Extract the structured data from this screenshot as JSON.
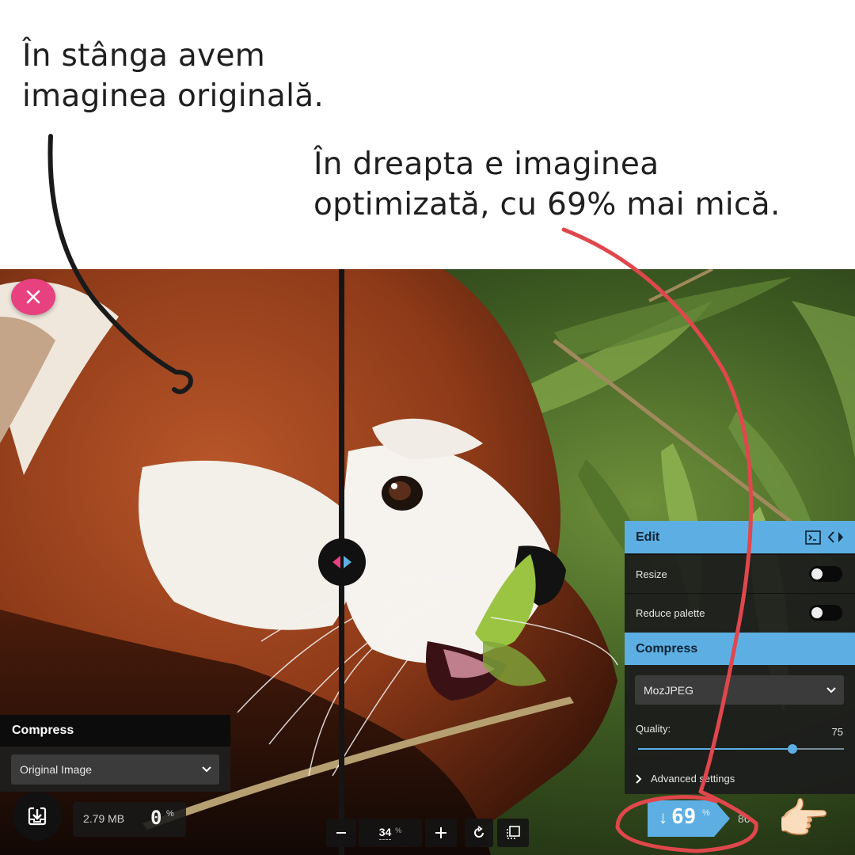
{
  "captions": {
    "left_line1": "În stânga avem",
    "left_line2": "imaginea originală.",
    "right_line1": "În dreapta e imaginea",
    "right_line2": "optimizată, cu 69% mai mică."
  },
  "colors": {
    "accent": "#5dafe3",
    "close": "#e8417f",
    "annotation_red": "#e0474c",
    "panel_bg": "#1c1c1c"
  },
  "left_panel": {
    "title": "Compress",
    "select_value": "Original Image",
    "size": "2.79 MB",
    "percent": "0",
    "percent_sign": "%"
  },
  "toolbar": {
    "zoom_value": "34",
    "zoom_unit": "%"
  },
  "right_panel": {
    "edit_title": "Edit",
    "resize_label": "Resize",
    "resize_on": false,
    "palette_label": "Reduce palette",
    "palette_on": false,
    "compress_title": "Compress",
    "codec_value": "MozJPEG",
    "quality_label": "Quality:",
    "quality_value": "75",
    "quality_fraction": 0.75,
    "advanced_label": "Advanced settings"
  },
  "result": {
    "arrow": "↓",
    "percent": "69",
    "percent_sign": "%",
    "size_partial": "86"
  },
  "icons": [
    "close-icon",
    "compare-handle-icon",
    "download-icon",
    "minus-icon",
    "plus-icon",
    "rotate-icon",
    "background-toggle-icon",
    "terminal-icon",
    "swap-sides-icon",
    "chevron-down-icon",
    "chevron-right-icon",
    "pointing-hand-emoji"
  ]
}
